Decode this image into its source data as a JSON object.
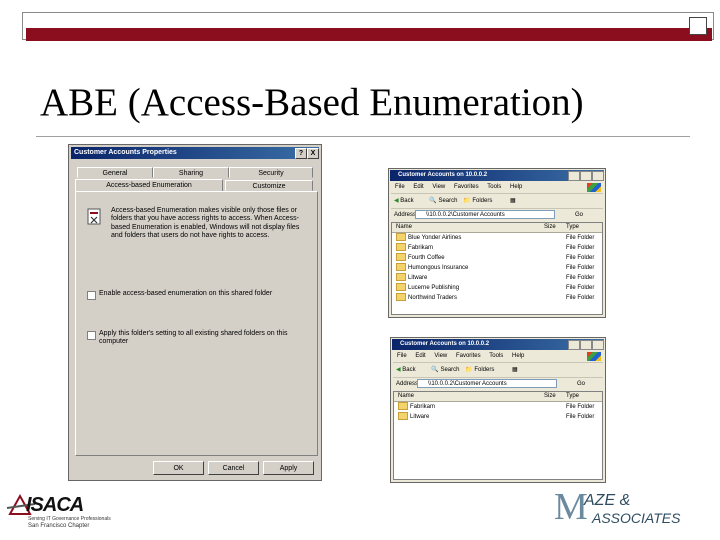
{
  "slide": {
    "title": "ABE (Access-Based Enumeration)",
    "accent_color": "#8b0e1f"
  },
  "dialog": {
    "title": "Customer Accounts Properties",
    "help_btn": "?",
    "close_btn": "X",
    "tabs_row1": [
      "General",
      "Sharing",
      "Security"
    ],
    "tabs_row2": [
      "Access-based Enumeration",
      "Customize"
    ],
    "description": "Access-based Enumeration makes visible only those files or folders that you have access rights to access. When Access-based Enumeration is enabled, Windows will not display files and folders that users do not have rights to access.",
    "option1": "Enable access-based enumeration on this shared folder",
    "option2": "Apply this folder's setting to all existing shared folders on this computer",
    "buttons": {
      "ok": "OK",
      "cancel": "Cancel",
      "apply": "Apply"
    }
  },
  "explorer_top": {
    "title": "Customer Accounts on 10.0.0.2",
    "menu": [
      "File",
      "Edit",
      "View",
      "Favorites",
      "Tools",
      "Help"
    ],
    "toolbar": {
      "back": "Back",
      "search": "Search",
      "folders": "Folders"
    },
    "address_label": "Address",
    "address": "\\\\10.0.0.2\\Customer Accounts",
    "go": "Go",
    "columns": {
      "name": "Name",
      "size": "Size",
      "type": "Type"
    },
    "rows": [
      {
        "name": "Blue Yonder Airlines",
        "type": "File Folder"
      },
      {
        "name": "Fabrikam",
        "type": "File Folder"
      },
      {
        "name": "Fourth Coffee",
        "type": "File Folder"
      },
      {
        "name": "Humongous Insurance",
        "type": "File Folder"
      },
      {
        "name": "Litware",
        "type": "File Folder"
      },
      {
        "name": "Lucerne Publishing",
        "type": "File Folder"
      },
      {
        "name": "Northwind Traders",
        "type": "File Folder"
      }
    ]
  },
  "explorer_bottom": {
    "title": "Customer Accounts on 10.0.0.2",
    "menu": [
      "File",
      "Edit",
      "View",
      "Favorites",
      "Tools",
      "Help"
    ],
    "toolbar": {
      "back": "Back",
      "search": "Search",
      "folders": "Folders"
    },
    "address_label": "Address",
    "address": "\\\\10.0.0.2\\Customer Accounts",
    "go": "Go",
    "columns": {
      "name": "Name",
      "size": "Size",
      "type": "Type"
    },
    "rows": [
      {
        "name": "Fabrikam",
        "type": "File Folder"
      },
      {
        "name": "Litware",
        "type": "File Folder"
      }
    ]
  },
  "logos": {
    "isaca": {
      "name": "ISACA",
      "line1": "Serving IT Governance Professionals",
      "line2": "San Francisco Chapter"
    },
    "maze": {
      "line1": "AZE &",
      "initial": "M",
      "line2": "ASSOCIATES"
    }
  }
}
